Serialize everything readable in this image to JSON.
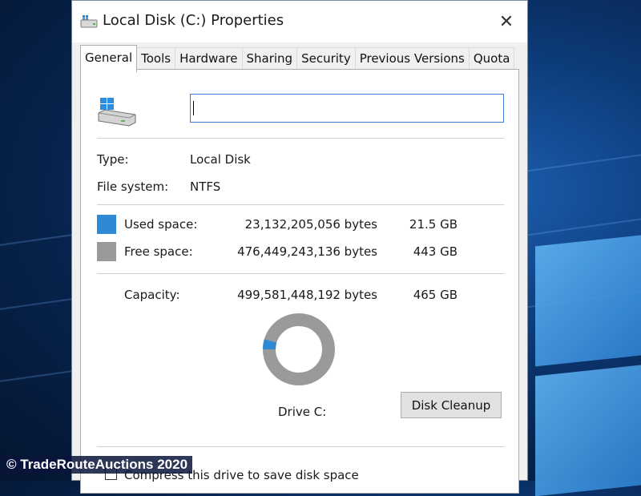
{
  "window": {
    "title": "Local Disk (C:) Properties",
    "close_glyph": "✕"
  },
  "tabs": [
    {
      "label": "General",
      "active": true
    },
    {
      "label": "Tools"
    },
    {
      "label": "Hardware"
    },
    {
      "label": "Sharing"
    },
    {
      "label": "Security"
    },
    {
      "label": "Previous Versions"
    },
    {
      "label": "Quota"
    }
  ],
  "general": {
    "volume_label_value": "",
    "type_label": "Type:",
    "type_value": "Local Disk",
    "fs_label": "File system:",
    "fs_value": "NTFS",
    "used": {
      "label": "Used space:",
      "bytes": "23,132,205,056 bytes",
      "size": "21.5 GB",
      "color": "#2f8ad6"
    },
    "free": {
      "label": "Free space:",
      "bytes": "476,449,243,136 bytes",
      "size": "443 GB",
      "color": "#9a9a9a"
    },
    "capacity": {
      "label": "Capacity:",
      "bytes": "499,581,448,192 bytes",
      "size": "465 GB"
    },
    "used_fraction": 0.046,
    "drive_label": "Drive C:",
    "cleanup_label": "Disk Cleanup",
    "compress_label": "Compress this drive to save disk space"
  },
  "icons": {
    "title": "drive-icon",
    "drive": "drive-icon",
    "close": "close-icon"
  },
  "watermark": "© TradeRouteAuctions 2020"
}
